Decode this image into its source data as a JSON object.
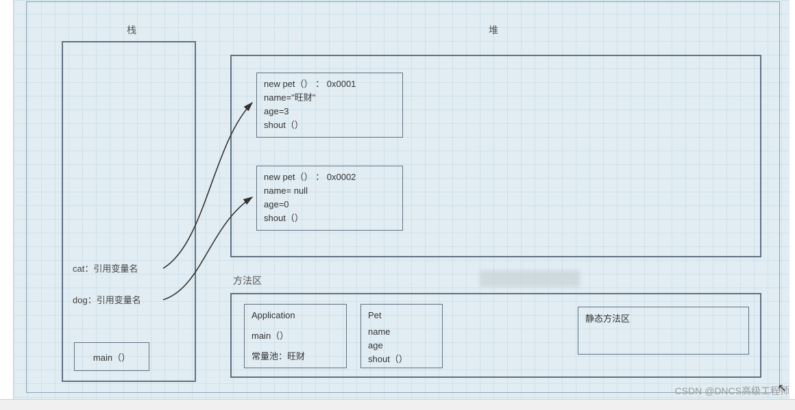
{
  "labels": {
    "stack": "栈",
    "heap": "堆",
    "methodArea": "方法区"
  },
  "stack": {
    "cat": "cat：引用变量名",
    "dog": "dog：引用变量名",
    "main": "main（）"
  },
  "heap": {
    "obj1": {
      "l1": "new pet（） ： 0x0001",
      "l2": "name=\"旺财\"",
      "l3": "age=3",
      "l4": "shout（）"
    },
    "obj2": {
      "l1": "new pet（） ： 0x0002",
      "l2": "name= null",
      "l3": "age=0",
      "l4": "shout（）"
    }
  },
  "methodArea": {
    "app": {
      "l1": "Application",
      "l2": "main（）",
      "l3": "常量池：旺财"
    },
    "pet": {
      "l1": "Pet",
      "l2": "name",
      "l3": "age",
      "l4": "shout（）"
    },
    "staticArea": "静态方法区"
  },
  "watermark": "CSDN @DNCS高级工程师"
}
